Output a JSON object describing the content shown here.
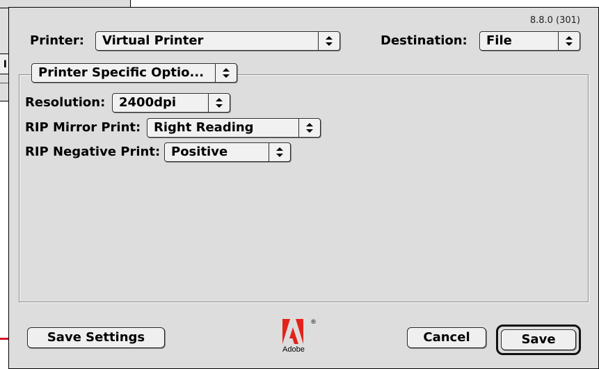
{
  "version": "8.8.0 (301)",
  "header": {
    "printer_label": "Printer:",
    "printer_value": "Virtual Printer",
    "destination_label": "Destination:",
    "destination_value": "File"
  },
  "section_popup": {
    "value": "Printer Specific Optio..."
  },
  "options": {
    "resolution_label": "Resolution:",
    "resolution_value": "2400dpi",
    "mirror_label": "RIP Mirror Print:",
    "mirror_value": "Right Reading",
    "negative_label": "RIP Negative Print:",
    "negative_value": "Positive"
  },
  "buttons": {
    "save_settings": "Save Settings",
    "cancel": "Cancel",
    "save": "Save"
  },
  "logo": {
    "text": "Adobe",
    "registered": "®"
  },
  "background_window": {
    "control_glyph": "I"
  },
  "colors": {
    "annotation_arrow": "#d0102a",
    "adobe_red": "#e2231a"
  },
  "icons": {
    "popup_arrows": "up-down-arrows-icon"
  }
}
